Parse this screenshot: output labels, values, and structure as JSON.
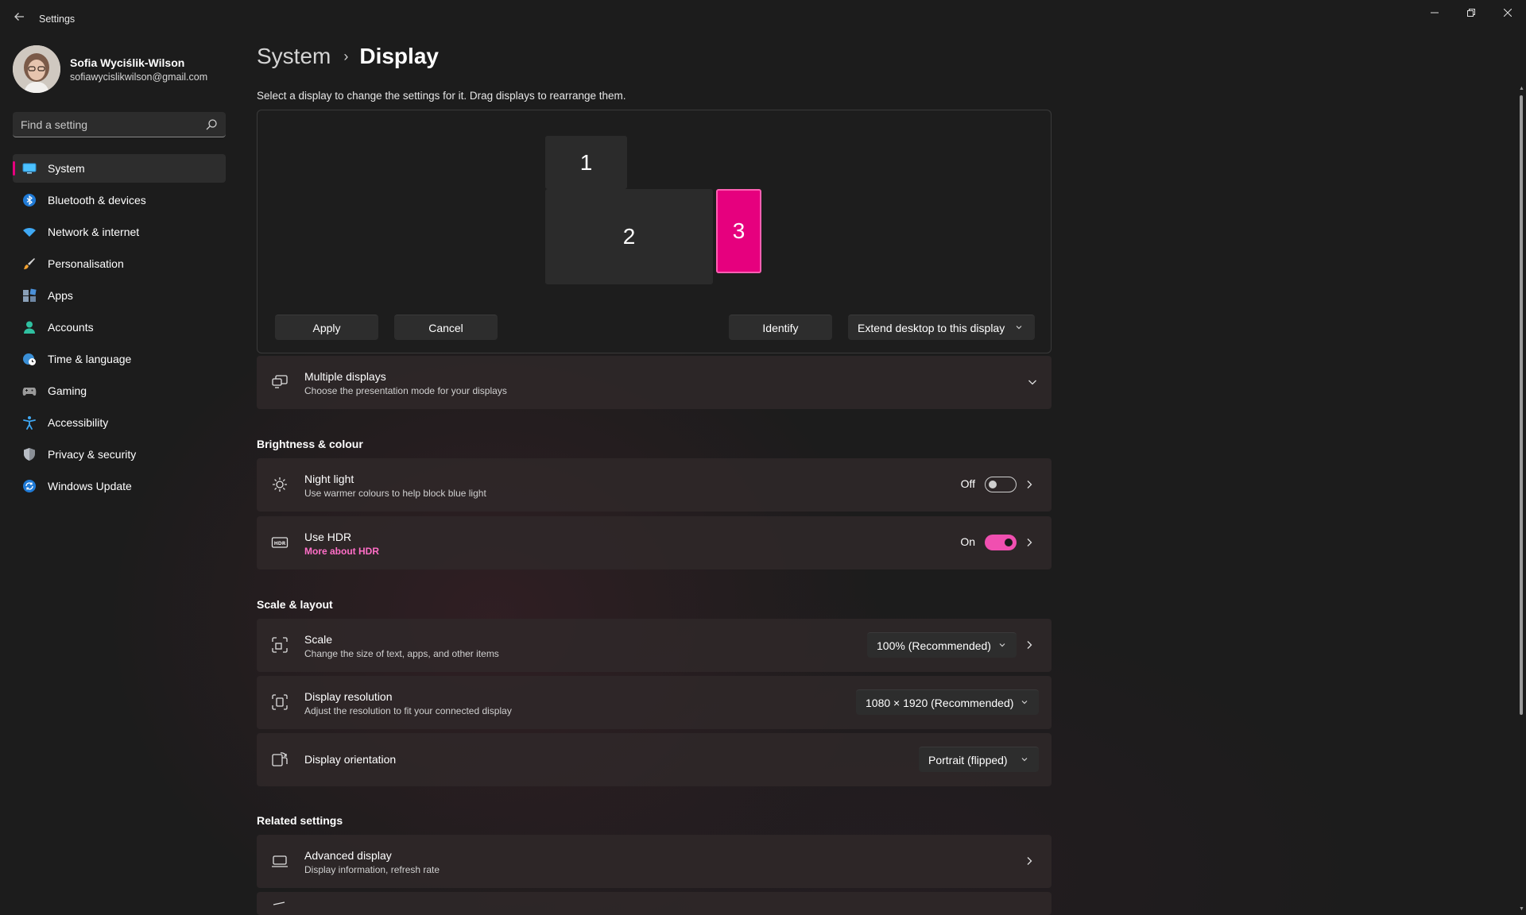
{
  "window": {
    "app_title": "Settings",
    "back_icon": "arrow-left-icon",
    "minimize_icon": "minimize-icon",
    "maximize_icon": "restore-icon",
    "close_icon": "close-icon"
  },
  "profile": {
    "name": "Sofia Wyciślik-Wilson",
    "email": "sofiawycislikwilson@gmail.com"
  },
  "search": {
    "placeholder": "Find a setting"
  },
  "sidebar": {
    "items": [
      {
        "label": "System",
        "icon": "monitor-icon",
        "active": true
      },
      {
        "label": "Bluetooth & devices",
        "icon": "bluetooth-icon"
      },
      {
        "label": "Network & internet",
        "icon": "wifi-icon"
      },
      {
        "label": "Personalisation",
        "icon": "brush-icon"
      },
      {
        "label": "Apps",
        "icon": "apps-icon"
      },
      {
        "label": "Accounts",
        "icon": "person-icon"
      },
      {
        "label": "Time & language",
        "icon": "globe-clock-icon"
      },
      {
        "label": "Gaming",
        "icon": "gamepad-icon"
      },
      {
        "label": "Accessibility",
        "icon": "accessibility-icon"
      },
      {
        "label": "Privacy & security",
        "icon": "shield-icon"
      },
      {
        "label": "Windows Update",
        "icon": "update-icon"
      }
    ]
  },
  "breadcrumb": {
    "parent": "System",
    "separator": "›",
    "current": "Display"
  },
  "instructions": "Select a display to change the settings for it. Drag displays to rearrange them.",
  "arrangement": {
    "monitors": [
      "1",
      "2",
      "3"
    ],
    "selected": "3",
    "apply_label": "Apply",
    "cancel_label": "Cancel",
    "identify_label": "Identify",
    "mode_value": "Extend desktop to this display"
  },
  "multiple_displays": {
    "title": "Multiple displays",
    "description": "Choose the presentation mode for your displays"
  },
  "brightness_section": {
    "heading": "Brightness & colour",
    "night_light": {
      "title": "Night light",
      "description": "Use warmer colours to help block blue light",
      "state": "Off"
    },
    "hdr": {
      "title": "Use HDR",
      "link": "More about HDR",
      "state": "On"
    }
  },
  "scale_section": {
    "heading": "Scale & layout",
    "scale": {
      "title": "Scale",
      "description": "Change the size of text, apps, and other items",
      "value": "100% (Recommended)"
    },
    "resolution": {
      "title": "Display resolution",
      "description": "Adjust the resolution to fit your connected display",
      "value": "1080 × 1920 (Recommended)"
    },
    "orientation": {
      "title": "Display orientation",
      "value": "Portrait (flipped)"
    }
  },
  "related_section": {
    "heading": "Related settings",
    "advanced": {
      "title": "Advanced display",
      "description": "Display information, refresh rate"
    }
  },
  "colors": {
    "accent": "#e6007e",
    "toggle_on": "#f04fb0",
    "link": "#ff6ec7",
    "background": "#1c1c1c"
  }
}
